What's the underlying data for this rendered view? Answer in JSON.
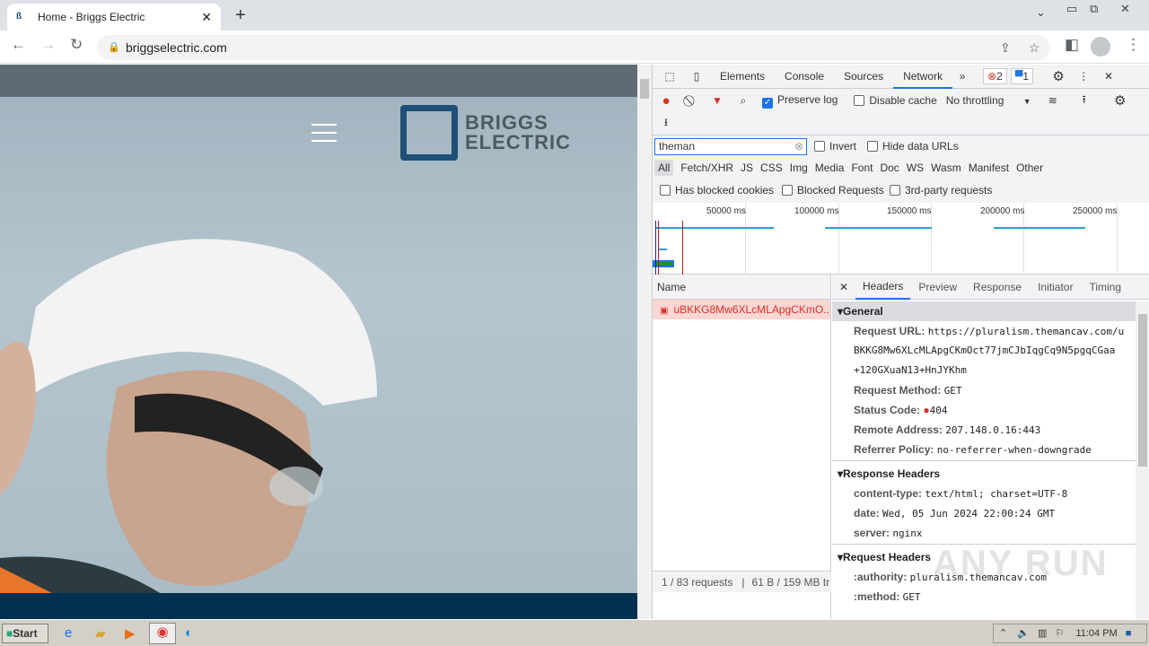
{
  "browser": {
    "tab_title": "Home - Briggs Electric",
    "url": "briggselectric.com"
  },
  "site": {
    "logo_line1": "BRIGGS",
    "logo_line2": "ELECTRIC"
  },
  "devtools": {
    "tabs": [
      "Elements",
      "Console",
      "Sources",
      "Network"
    ],
    "active_tab": "Network",
    "error_count": "2",
    "message_count": "1",
    "preserve_log": "Preserve log",
    "preserve_log_checked": true,
    "disable_cache": "Disable cache",
    "throttling": "No throttling",
    "filter_value": "theman",
    "invert": "Invert",
    "hide_data_urls": "Hide data URLs",
    "types": [
      "All",
      "Fetch/XHR",
      "JS",
      "CSS",
      "Img",
      "Media",
      "Font",
      "Doc",
      "WS",
      "Wasm",
      "Manifest",
      "Other"
    ],
    "blocked_cookies": "Has blocked cookies",
    "blocked_requests": "Blocked Requests",
    "third_party": "3rd-party requests",
    "timeline_ticks": [
      "50000 ms",
      "100000 ms",
      "150000 ms",
      "200000 ms",
      "250000 ms"
    ],
    "name_header": "Name",
    "request_name": "uBKKG8Mw6XLcMLApgCKmO...",
    "status_requests": "1 / 83 requests",
    "status_transfer": "61 B / 159 MB tr",
    "detail_tabs": [
      "Headers",
      "Preview",
      "Response",
      "Initiator",
      "Timing"
    ],
    "general": {
      "title": "General",
      "request_url_label": "Request URL:",
      "request_url_1": "https://pluralism.themancav.com/u",
      "request_url_2": "BKKG8Mw6XLcMLApgCKmOct77jmCJbIqgCq9N5pgqCGaa",
      "request_url_3": "+120GXuaN13+HnJYKhm",
      "method_label": "Request Method:",
      "method": "GET",
      "status_label": "Status Code:",
      "status": "404",
      "remote_label": "Remote Address:",
      "remote": "207.148.0.16:443",
      "referrer_label": "Referrer Policy:",
      "referrer": "no-referrer-when-downgrade"
    },
    "response_headers": {
      "title": "Response Headers",
      "ct_label": "content-type:",
      "ct": "text/html; charset=UTF-8",
      "date_label": "date:",
      "date": "Wed, 05 Jun 2024 22:00:24 GMT",
      "server_label": "server:",
      "server": "nginx"
    },
    "request_headers": {
      "title": "Request Headers",
      "authority_label": ":authority:",
      "authority": "pluralism.themancav.com",
      "method_label": ":method:",
      "method": "GET"
    }
  },
  "taskbar": {
    "start": "Start",
    "time": "11:04 PM"
  },
  "watermark": "ANY RUN"
}
